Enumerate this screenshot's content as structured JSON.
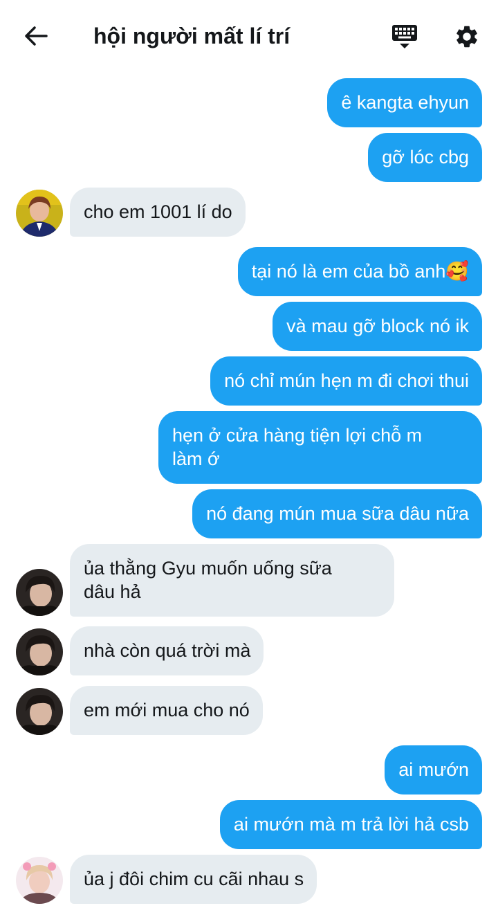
{
  "header": {
    "title": "hội người mất lí trí",
    "back_icon": "arrow-left-icon",
    "keyboard_icon": "keyboard-icon",
    "settings_icon": "gear-icon"
  },
  "colors": {
    "outgoing_bubble": "#1da1f2",
    "incoming_bubble": "#e6ecf0"
  },
  "messages": [
    {
      "dir": "out",
      "text": "ê kangta ehyun"
    },
    {
      "dir": "out",
      "text": "gỡ lóc cbg"
    },
    {
      "dir": "in",
      "text": "cho em 1001 lí do"
    },
    {
      "dir": "out",
      "text": "tại nó là em của bồ anh🥰"
    },
    {
      "dir": "out",
      "text": "và mau gỡ block nó ik"
    },
    {
      "dir": "out",
      "text": "nó chỉ mún hẹn m đi chơi thui"
    },
    {
      "dir": "out",
      "line1": "hẹn ở cửa hàng tiện lợi chỗ m",
      "line2": "làm ớ"
    },
    {
      "dir": "out",
      "text": "nó đang mún mua sữa dâu nữa"
    },
    {
      "dir": "in",
      "line1": "ủa thằng Gyu muốn uống sữa",
      "line2": "dâu hả"
    },
    {
      "dir": "in",
      "text": "nhà còn quá trời mà"
    },
    {
      "dir": "in",
      "text": "em mới mua cho nó"
    },
    {
      "dir": "out",
      "text": "ai mướn"
    },
    {
      "dir": "out",
      "text": "ai mướn mà m trả lời hả csb"
    },
    {
      "dir": "in",
      "text": "ủa j đôi chim cu cãi nhau s"
    }
  ]
}
